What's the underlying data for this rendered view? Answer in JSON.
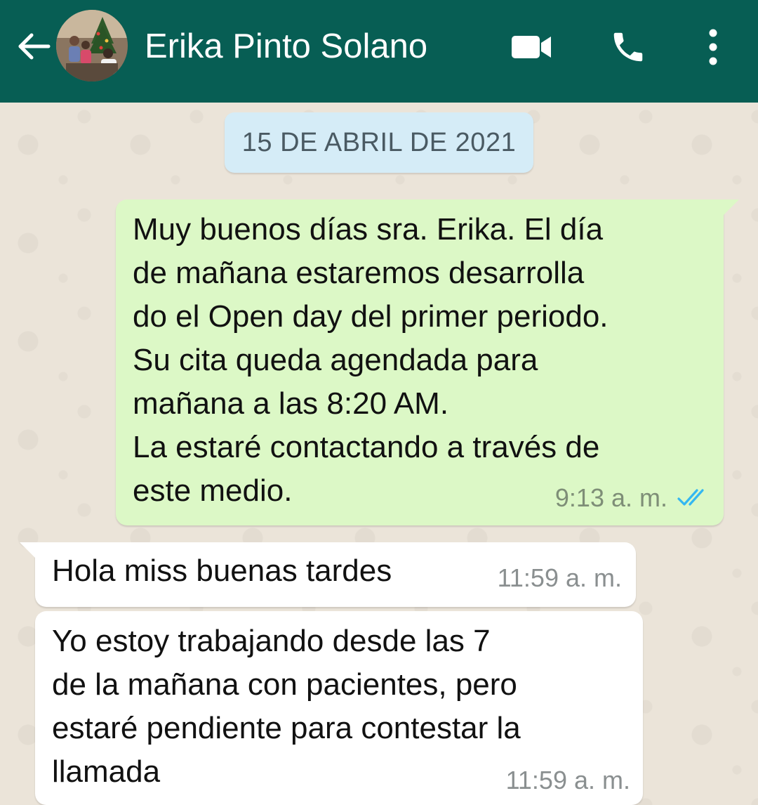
{
  "header": {
    "contact_name": "Erika Pinto Solano",
    "back_icon": "arrow-left",
    "video_icon": "video-camera",
    "call_icon": "phone",
    "menu_icon": "vertical-dots",
    "background_color": "#075e54"
  },
  "chat": {
    "date_label": "15 DE ABRIL DE 2021",
    "messages": [
      {
        "direction": "outgoing",
        "text": "Muy buenos días sra. Erika. El día\nde mañana estaremos desarrolla\ndo el Open day del primer periodo.\nSu cita queda agendada para\nmañana a las 8:20 AM.\nLa estaré contactando a través de\neste medio.",
        "time": "9:13 a. m.",
        "status": "read"
      },
      {
        "direction": "incoming",
        "text": "Hola miss buenas tardes",
        "time": "11:59 a. m."
      },
      {
        "direction": "incoming",
        "text": "Yo estoy trabajando desde las 7\nde la mañana con pacientes, pero\nestaré pendiente para contestar la\nllamada",
        "time": "11:59 a. m."
      }
    ],
    "colors": {
      "outgoing_bubble": "#dcf8c6",
      "incoming_bubble": "#ffffff",
      "date_chip": "#d5ecf7",
      "read_ticks": "#34b7f1"
    }
  }
}
